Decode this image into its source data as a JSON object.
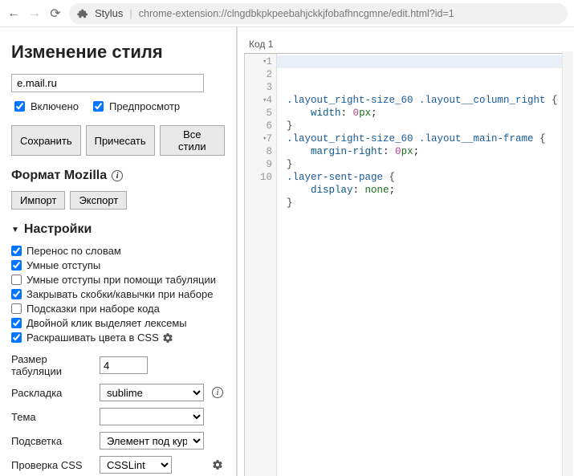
{
  "toolbar": {
    "ext_name": "Stylus",
    "url": "chrome-extension://clngdbkpkpeebahjckkjfobafhncgmne/edit.html?id=1"
  },
  "left": {
    "title": "Изменение стиля",
    "domain_value": "e.mail.ru",
    "chk_enabled": "Включено",
    "chk_preview": "Предпросмотр",
    "btn_save": "Сохранить",
    "btn_beautify": "Причесать",
    "btn_all": "Все стили",
    "format_header": "Формат Mozilla",
    "btn_import": "Импорт",
    "btn_export": "Экспорт",
    "settings_header": "Настройки",
    "options": [
      {
        "label": "Перенос по словам",
        "checked": true
      },
      {
        "label": "Умные отступы",
        "checked": true
      },
      {
        "label": "Умные отступы при помощи табуляции",
        "checked": false
      },
      {
        "label": "Закрывать скобки/кавычки при наборе",
        "checked": true
      },
      {
        "label": "Подсказки при наборе кода",
        "checked": false
      },
      {
        "label": "Двойной клик выделяет лексемы",
        "checked": true
      },
      {
        "label": "Раскрашивать цвета в CSS",
        "checked": true,
        "gear": true
      }
    ],
    "form": {
      "tab_size_label": "Размер табуляции",
      "tab_size_value": "4",
      "keymap_label": "Раскладка",
      "keymap_value": "sublime",
      "theme_label": "Тема",
      "theme_value": "",
      "highlight_label": "Подсветка",
      "highlight_value": "Элемент под курсором",
      "csslint_label": "Проверка CSS",
      "csslint_value": "CSSLint"
    }
  },
  "editor": {
    "label": "Код 1",
    "lines": [
      {
        "n": 1,
        "fold": true,
        "tokens": [
          [
            ".layout_right-size_60 ",
            "sel"
          ],
          [
            ".layout__column_right ",
            "sel"
          ],
          [
            "{",
            "br"
          ]
        ]
      },
      {
        "n": 2,
        "fold": false,
        "tokens": [
          [
            "    ",
            ""
          ],
          [
            "width",
            "prop"
          ],
          [
            ": ",
            ""
          ],
          [
            "0",
            "num"
          ],
          [
            "px",
            "kw"
          ],
          [
            ";",
            ""
          ]
        ]
      },
      {
        "n": 3,
        "fold": false,
        "tokens": [
          [
            "}",
            "br"
          ]
        ]
      },
      {
        "n": 4,
        "fold": true,
        "tokens": [
          [
            ".layout_right-size_60 ",
            "sel"
          ],
          [
            ".layout__main-frame ",
            "sel"
          ],
          [
            "{",
            "br"
          ]
        ]
      },
      {
        "n": 5,
        "fold": false,
        "tokens": [
          [
            "    ",
            ""
          ],
          [
            "margin-right",
            "prop"
          ],
          [
            ": ",
            ""
          ],
          [
            "0",
            "num"
          ],
          [
            "px",
            "kw"
          ],
          [
            ";",
            ""
          ]
        ]
      },
      {
        "n": 6,
        "fold": false,
        "tokens": [
          [
            "}",
            "br"
          ]
        ]
      },
      {
        "n": 7,
        "fold": true,
        "tokens": [
          [
            ".layer-sent-page ",
            "sel"
          ],
          [
            "{",
            "br"
          ]
        ]
      },
      {
        "n": 8,
        "fold": false,
        "tokens": [
          [
            "    ",
            ""
          ],
          [
            "display",
            "prop"
          ],
          [
            ": ",
            ""
          ],
          [
            "none",
            "kw"
          ],
          [
            ";",
            ""
          ]
        ]
      },
      {
        "n": 9,
        "fold": false,
        "tokens": [
          [
            "}",
            "br"
          ]
        ]
      },
      {
        "n": 10,
        "fold": false,
        "tokens": []
      }
    ]
  }
}
